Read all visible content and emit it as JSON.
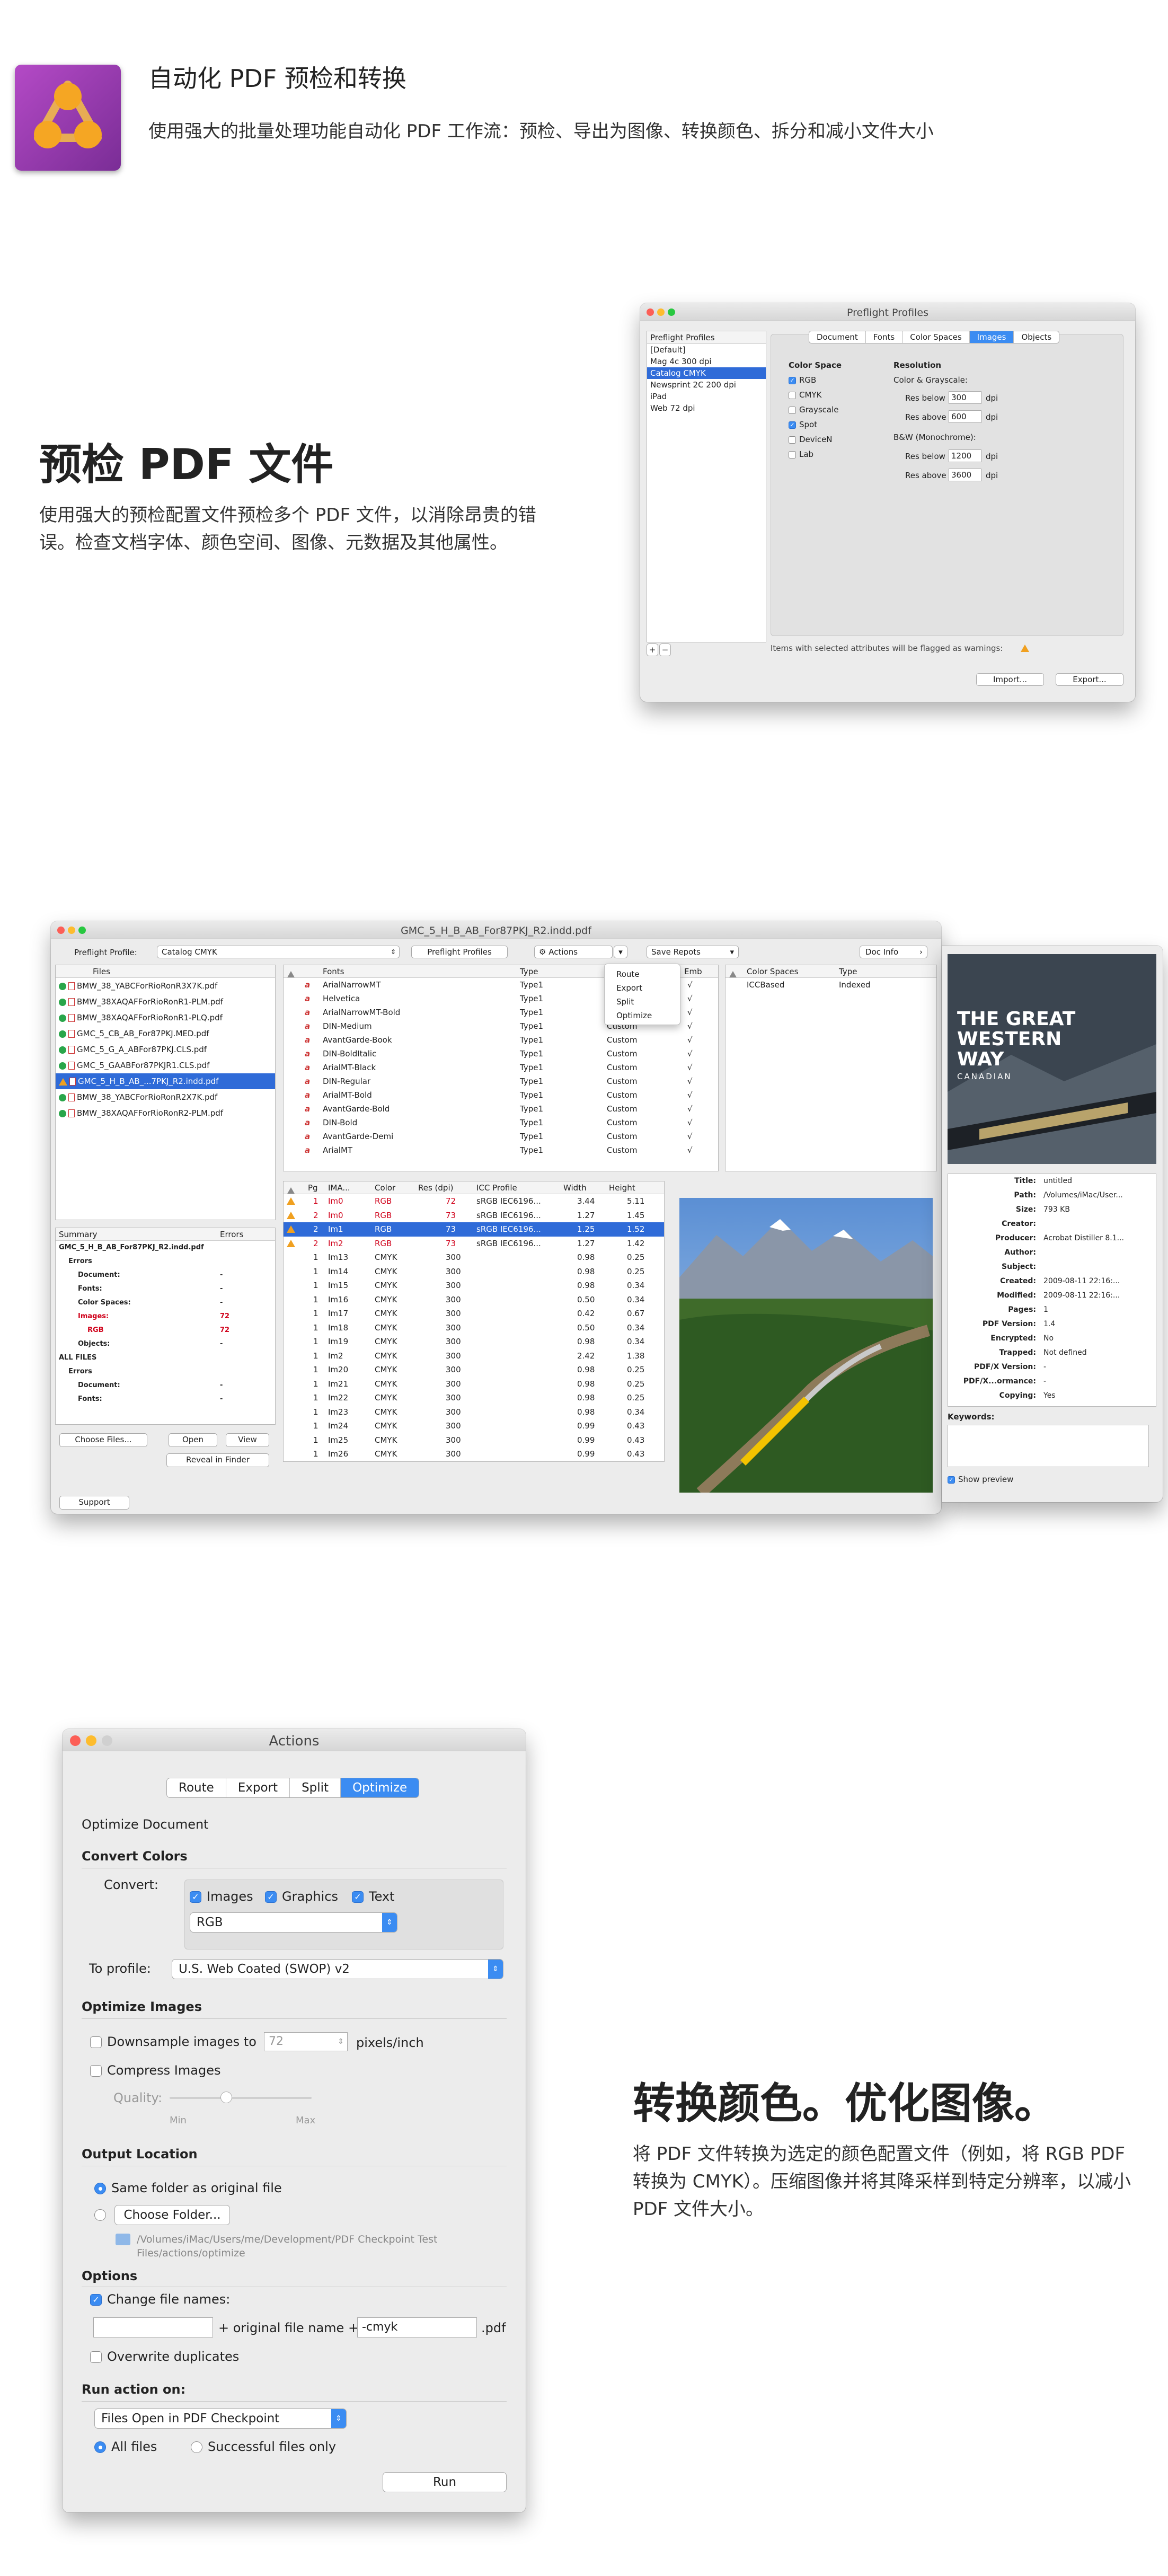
{
  "header": {
    "title": "自动化 PDF 预检和转换",
    "subtitle": "使用强大的批量处理功能自动化 PDF 工作流：预检、导出为图像、转换颜色、拆分和减小文件大小"
  },
  "section1": {
    "heading": "预检 PDF 文件",
    "body": "使用强大的预检配置文件预检多个 PDF 文件，以消除昂贵的错误。检查文档字体、颜色空间、图像、元数据及其他属性。"
  },
  "section2": {
    "heading": "转换颜色。优化图像。",
    "body": "将 PDF 文件转换为选定的颜色配置文件（例如，将 RGB PDF 转换为 CMYK）。压缩图像并将其降采样到特定分辨率，以减小 PDF 文件大小。"
  },
  "preflight": {
    "title": "Preflight Profiles",
    "list_header": "Preflight Profiles",
    "profiles": [
      "[Default]",
      "Mag 4c 300 dpi",
      "Catalog CMYK",
      "Newsprint 2C 200 dpi",
      "iPad",
      "Web 72 dpi"
    ],
    "selected_profile": "Catalog CMYK",
    "tabs": [
      "Document",
      "Fonts",
      "Color Spaces",
      "Images",
      "Objects"
    ],
    "active_tab": "Images",
    "color_space_label": "Color Space",
    "color_spaces": [
      {
        "name": "RGB",
        "checked": true
      },
      {
        "name": "CMYK",
        "checked": false
      },
      {
        "name": "Grayscale",
        "checked": false
      },
      {
        "name": "Spot",
        "checked": true
      },
      {
        "name": "DeviceN",
        "checked": false
      },
      {
        "name": "Lab",
        "checked": false
      }
    ],
    "resolution_label": "Resolution",
    "color_gray_label": "Color & Grayscale:",
    "bw_label": "B&W (Monochrome):",
    "res_below": "Res below",
    "res_above": "Res above",
    "dpi": "dpi",
    "cg_below": "300",
    "cg_above": "600",
    "bw_below": "1200",
    "bw_above": "3600",
    "warning_note": "Items with selected attributes will be flagged as warnings:",
    "import_btn": "Import...",
    "export_btn": "Export...",
    "plus": "+",
    "minus": "−"
  },
  "main": {
    "title": "GMC_5_H_B_AB_For87PKJ_R2.indd.pdf",
    "profile_label": "Preflight Profile:",
    "profile_value": "Catalog CMYK",
    "preflight_profiles_btn": "Preflight Profiles",
    "actions_btn": "Actions",
    "save_reports_btn": "Save Repots",
    "doc_info_btn": "Doc Info",
    "actions_menu": [
      "Route",
      "Export",
      "Split",
      "Optimize"
    ],
    "files_header": "Files",
    "files": [
      {
        "name": "BMW_38_YABCForRioRonR3X7K.pdf",
        "status": "ok"
      },
      {
        "name": "BMW_38XAQAFForRioRonR1-PLM.pdf",
        "status": "ok"
      },
      {
        "name": "BMW_38XAQAFForRioRonR1-PLQ.pdf",
        "status": "ok"
      },
      {
        "name": "GMC_5_CB_AB_For87PKJ.MED.pdf",
        "status": "ok"
      },
      {
        "name": "GMC_5_G_A_ABFor87PKJ.CLS.pdf",
        "status": "ok"
      },
      {
        "name": "GMC_5_GAABFor87PKJR1.CLS.pdf",
        "status": "ok"
      },
      {
        "name": "GMC_5_H_B_AB_...7PKJ_R2.indd.pdf",
        "status": "warn"
      },
      {
        "name": "BMW_38_YABCForRioRonR2X7K.pdf",
        "status": "ok"
      },
      {
        "name": "BMW_38XAQAFForRioRonR2-PLM.pdf",
        "status": "ok"
      }
    ],
    "selected_file_index": 6,
    "fonts_headers": [
      "Fonts",
      "Type",
      "Emb"
    ],
    "fonts": [
      {
        "name": "ArialNarrowMT",
        "type": "Type1",
        "enc": "",
        "emb": "√"
      },
      {
        "name": "Helvetica",
        "type": "Type1",
        "enc": "Custom",
        "emb": "√"
      },
      {
        "name": "ArialNarrowMT-Bold",
        "type": "Type1",
        "enc": "Custom",
        "emb": "√"
      },
      {
        "name": "DIN-Medium",
        "type": "Type1",
        "enc": "Custom",
        "emb": "√"
      },
      {
        "name": "AvantGarde-Book",
        "type": "Type1",
        "enc": "Custom",
        "emb": "√"
      },
      {
        "name": "DIN-BoldItalic",
        "type": "Type1",
        "enc": "Custom",
        "emb": "√"
      },
      {
        "name": "ArialMT-Black",
        "type": "Type1",
        "enc": "Custom",
        "emb": "√"
      },
      {
        "name": "DIN-Regular",
        "type": "Type1",
        "enc": "Custom",
        "emb": "√"
      },
      {
        "name": "ArialMT-Bold",
        "type": "Type1",
        "enc": "Custom",
        "emb": "√"
      },
      {
        "name": "AvantGarde-Bold",
        "type": "Type1",
        "enc": "Custom",
        "emb": "√"
      },
      {
        "name": "DIN-Bold",
        "type": "Type1",
        "enc": "Custom",
        "emb": "√"
      },
      {
        "name": "AvantGarde-Demi",
        "type": "Type1",
        "enc": "Custom",
        "emb": "√"
      },
      {
        "name": "ArialMT",
        "type": "Type1",
        "enc": "Custom",
        "emb": "√"
      }
    ],
    "cs_headers": [
      "Color Spaces",
      "Type"
    ],
    "cs_rows": [
      {
        "name": "ICCBased",
        "type": "Indexed"
      }
    ],
    "summary_headers": [
      "Summary",
      "Errors"
    ],
    "summary": [
      {
        "label": "GMC_5_H_B_AB_For87PKJ_R2.indd.pdf",
        "val": "",
        "level": 0,
        "red": false
      },
      {
        "label": "Errors",
        "val": "",
        "level": 1,
        "red": false
      },
      {
        "label": "Document:",
        "val": "-",
        "level": 2,
        "red": false
      },
      {
        "label": "Fonts:",
        "val": "-",
        "level": 2,
        "red": false
      },
      {
        "label": "Color Spaces:",
        "val": "-",
        "level": 2,
        "red": false
      },
      {
        "label": "Images:",
        "val": "72",
        "level": 2,
        "red": true
      },
      {
        "label": "RGB",
        "val": "72",
        "level": 3,
        "red": true
      },
      {
        "label": "Objects:",
        "val": "-",
        "level": 2,
        "red": false
      },
      {
        "label": "ALL FILES",
        "val": "",
        "level": 0,
        "red": false
      },
      {
        "label": "Errors",
        "val": "",
        "level": 1,
        "red": false
      },
      {
        "label": "Document:",
        "val": "-",
        "level": 2,
        "red": false
      },
      {
        "label": "Fonts:",
        "val": "-",
        "level": 2,
        "red": false
      }
    ],
    "choose_files_btn": "Choose Files...",
    "open_btn": "Open",
    "view_btn": "View",
    "reveal_btn": "Reveal in Finder",
    "support_btn": "Support",
    "images_headers": [
      "Pg",
      "IMA...",
      "Color",
      "Res (dpi)",
      "ICC Profile",
      "Width",
      "Height"
    ],
    "images": [
      {
        "warn": true,
        "pg": "1",
        "name": "Im0",
        "color": "RGB",
        "res": "72",
        "icc": "sRGB IEC6196...",
        "w": "3.44",
        "h": "5.11",
        "red": true
      },
      {
        "warn": true,
        "pg": "2",
        "name": "Im0",
        "color": "RGB",
        "res": "73",
        "icc": "sRGB IEC6196...",
        "w": "1.27",
        "h": "1.45",
        "red": true
      },
      {
        "warn": true,
        "pg": "2",
        "name": "Im1",
        "color": "RGB",
        "res": "73",
        "icc": "sRGB IEC6196...",
        "w": "1.25",
        "h": "1.52",
        "red": true
      },
      {
        "warn": true,
        "pg": "2",
        "name": "Im2",
        "color": "RGB",
        "res": "73",
        "icc": "sRGB IEC6196...",
        "w": "1.27",
        "h": "1.42",
        "red": true
      },
      {
        "warn": false,
        "pg": "1",
        "name": "Im13",
        "color": "CMYK",
        "res": "300",
        "icc": "",
        "w": "0.98",
        "h": "0.25",
        "red": false
      },
      {
        "warn": false,
        "pg": "1",
        "name": "Im14",
        "color": "CMYK",
        "res": "300",
        "icc": "",
        "w": "0.98",
        "h": "0.25",
        "red": false
      },
      {
        "warn": false,
        "pg": "1",
        "name": "Im15",
        "color": "CMYK",
        "res": "300",
        "icc": "",
        "w": "0.98",
        "h": "0.34",
        "red": false
      },
      {
        "warn": false,
        "pg": "1",
        "name": "Im16",
        "color": "CMYK",
        "res": "300",
        "icc": "",
        "w": "0.50",
        "h": "0.34",
        "red": false
      },
      {
        "warn": false,
        "pg": "1",
        "name": "Im17",
        "color": "CMYK",
        "res": "300",
        "icc": "",
        "w": "0.42",
        "h": "0.67",
        "red": false
      },
      {
        "warn": false,
        "pg": "1",
        "name": "Im18",
        "color": "CMYK",
        "res": "300",
        "icc": "",
        "w": "0.50",
        "h": "0.34",
        "red": false
      },
      {
        "warn": false,
        "pg": "1",
        "name": "Im19",
        "color": "CMYK",
        "res": "300",
        "icc": "",
        "w": "0.98",
        "h": "0.34",
        "red": false
      },
      {
        "warn": false,
        "pg": "1",
        "name": "Im2",
        "color": "CMYK",
        "res": "300",
        "icc": "",
        "w": "2.42",
        "h": "1.38",
        "red": false
      },
      {
        "warn": false,
        "pg": "1",
        "name": "Im20",
        "color": "CMYK",
        "res": "300",
        "icc": "",
        "w": "0.98",
        "h": "0.25",
        "red": false
      },
      {
        "warn": false,
        "pg": "1",
        "name": "Im21",
        "color": "CMYK",
        "res": "300",
        "icc": "",
        "w": "0.98",
        "h": "0.25",
        "red": false
      },
      {
        "warn": false,
        "pg": "1",
        "name": "Im22",
        "color": "CMYK",
        "res": "300",
        "icc": "",
        "w": "0.98",
        "h": "0.25",
        "red": false
      },
      {
        "warn": false,
        "pg": "1",
        "name": "Im23",
        "color": "CMYK",
        "res": "300",
        "icc": "",
        "w": "0.98",
        "h": "0.34",
        "red": false
      },
      {
        "warn": false,
        "pg": "1",
        "name": "Im24",
        "color": "CMYK",
        "res": "300",
        "icc": "",
        "w": "0.99",
        "h": "0.43",
        "red": false
      },
      {
        "warn": false,
        "pg": "1",
        "name": "Im25",
        "color": "CMYK",
        "res": "300",
        "icc": "",
        "w": "0.99",
        "h": "0.43",
        "red": false
      },
      {
        "warn": false,
        "pg": "1",
        "name": "Im26",
        "color": "CMYK",
        "res": "300",
        "icc": "",
        "w": "0.99",
        "h": "0.43",
        "red": false
      }
    ],
    "selected_image_index": 2
  },
  "docinfo": {
    "cover": {
      "title1": "THE GREAT",
      "title2": "WESTERN",
      "title3": "WAY",
      "sub": "CANADIAN"
    },
    "fields": [
      {
        "k": "Title:",
        "v": "untitled"
      },
      {
        "k": "Path:",
        "v": "/Volumes/iMac/User..."
      },
      {
        "k": "Size:",
        "v": "793 KB"
      },
      {
        "k": "Creator:",
        "v": ""
      },
      {
        "k": "Producer:",
        "v": "Acrobat Distiller 8.1..."
      },
      {
        "k": "Author:",
        "v": ""
      },
      {
        "k": "Subject:",
        "v": ""
      },
      {
        "k": "Created:",
        "v": "2009-08-11 22:16:..."
      },
      {
        "k": "Modified:",
        "v": "2009-08-11 22:16:..."
      },
      {
        "k": "Pages:",
        "v": "1"
      },
      {
        "k": "PDF Version:",
        "v": "1.4"
      },
      {
        "k": "Encrypted:",
        "v": "No"
      },
      {
        "k": "Trapped:",
        "v": "Not defined"
      },
      {
        "k": "PDF/X Version:",
        "v": "-"
      },
      {
        "k": "PDF/X...ormance:",
        "v": "-"
      },
      {
        "k": "Copying:",
        "v": "Yes"
      }
    ],
    "keywords_label": "Keywords:",
    "show_preview": "Show preview"
  },
  "actions": {
    "title": "Actions",
    "tabs": [
      "Route",
      "Export",
      "Split",
      "Optimize"
    ],
    "active_tab": "Optimize",
    "optimize_doc": "Optimize Document",
    "convert_colors": "Convert Colors",
    "convert_label": "Convert:",
    "chk_images": "Images",
    "chk_graphics": "Graphics",
    "chk_text": "Text",
    "color_mode": "RGB",
    "to_profile_label": "To profile:",
    "to_profile": "U.S. Web Coated (SWOP) v2",
    "optimize_images": "Optimize Images",
    "downsample": "Downsample images to",
    "downsample_value": "72",
    "ppi": "pixels/inch",
    "compress": "Compress Images",
    "quality": "Quality:",
    "quality_level": 0.4,
    "min": "Min",
    "max": "Max",
    "output_location": "Output Location",
    "same_folder": "Same folder as original file",
    "choose_folder": "Choose Folder...",
    "folder_path": "/Volumes/iMac/Users/me/Development/PDF Checkpoint Test Files/actions/optimize",
    "options": "Options",
    "change_names": "Change file names:",
    "prefix": "",
    "plus_original": "+ original file name +",
    "suffix": "-cmyk",
    "ext": ".pdf",
    "overwrite": "Overwrite duplicates",
    "run_on": "Run action on:",
    "run_on_value": "Files Open in PDF Checkpoint",
    "all_files": "All files",
    "successful": "Successful files only",
    "run_btn": "Run"
  }
}
